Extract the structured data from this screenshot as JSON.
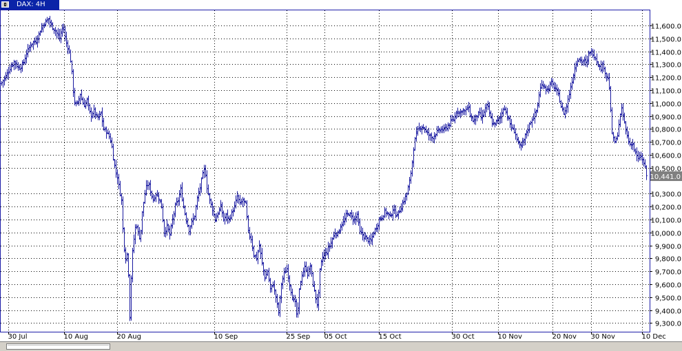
{
  "window": {
    "title": "DAX: 4H"
  },
  "chart_data": {
    "type": "ohlc",
    "symbol": "DAX",
    "timeframe": "4H",
    "x_ticks": [
      "30 Jul",
      "10 Aug",
      "20 Aug",
      "10 Sep",
      "25 Sep",
      "05 Oct",
      "15 Oct",
      "30 Oct",
      "10 Nov",
      "20 Nov",
      "30 Nov",
      "10 Dec"
    ],
    "y_ticks": [
      "11,600.0",
      "11,500.0",
      "11,400.0",
      "11,300.0",
      "11,200.0",
      "11,100.0",
      "11,000.0",
      "10,900.0",
      "10,800.0",
      "10,700.0",
      "10,600.0",
      "10,500.0",
      "10,300.0",
      "10,200.0",
      "10,100.0",
      "10,000.0",
      "9,900.0",
      "9,800.0",
      "9,700.0",
      "9,600.0",
      "9,500.0",
      "9,400.0",
      "9,300.0"
    ],
    "y_range": [
      9250,
      11700
    ],
    "last_price_label": "10,441.0",
    "last_price": 10441,
    "grid": true,
    "colors": {
      "bars": "#1818a0",
      "grid": "#000000",
      "frame": "#1c1ca8",
      "price_tag": "#808080"
    },
    "close_path": [
      [
        1,
        11150
      ],
      [
        7,
        11200
      ],
      [
        13,
        11260
      ],
      [
        20,
        11320
      ],
      [
        27,
        11270
      ],
      [
        33,
        11300
      ],
      [
        39,
        11400
      ],
      [
        45,
        11460
      ],
      [
        52,
        11480
      ],
      [
        58,
        11560
      ],
      [
        64,
        11620
      ],
      [
        70,
        11650
      ],
      [
        74,
        11600
      ],
      [
        80,
        11560
      ],
      [
        86,
        11500
      ],
      [
        91,
        11600
      ],
      [
        95,
        11480
      ],
      [
        99,
        11420
      ],
      [
        103,
        11300
      ],
      [
        107,
        11020
      ],
      [
        111,
        10980
      ],
      [
        116,
        11070
      ],
      [
        121,
        10980
      ],
      [
        126,
        11020
      ],
      [
        131,
        10900
      ],
      [
        136,
        10940
      ],
      [
        141,
        10880
      ],
      [
        146,
        10920
      ],
      [
        150,
        10800
      ],
      [
        154,
        10780
      ],
      [
        158,
        10740
      ],
      [
        161,
        10700
      ],
      [
        164,
        10580
      ],
      [
        167,
        10480
      ],
      [
        170,
        10430
      ],
      [
        173,
        10330
      ],
      [
        176,
        10250
      ],
      [
        179,
        9920
      ],
      [
        182,
        9800
      ],
      [
        185,
        9850
      ],
      [
        188,
        9350
      ],
      [
        191,
        9800
      ],
      [
        194,
        9950
      ],
      [
        197,
        10080
      ],
      [
        200,
        10000
      ],
      [
        203,
        9950
      ],
      [
        206,
        10150
      ],
      [
        209,
        10270
      ],
      [
        212,
        10350
      ],
      [
        215,
        10380
      ],
      [
        218,
        10320
      ],
      [
        222,
        10250
      ],
      [
        226,
        10300
      ],
      [
        230,
        10270
      ],
      [
        234,
        10200
      ],
      [
        238,
        10000
      ],
      [
        242,
        10050
      ],
      [
        246,
        9980
      ],
      [
        250,
        10100
      ],
      [
        254,
        10200
      ],
      [
        258,
        10250
      ],
      [
        262,
        10330
      ],
      [
        266,
        10200
      ],
      [
        270,
        10100
      ],
      [
        274,
        10020
      ],
      [
        278,
        10080
      ],
      [
        282,
        10130
      ],
      [
        286,
        10260
      ],
      [
        290,
        10350
      ],
      [
        294,
        10450
      ],
      [
        297,
        10500
      ],
      [
        300,
        10350
      ],
      [
        304,
        10250
      ],
      [
        308,
        10180
      ],
      [
        312,
        10100
      ],
      [
        316,
        10150
      ],
      [
        320,
        10200
      ],
      [
        324,
        10100
      ],
      [
        328,
        10130
      ],
      [
        332,
        10100
      ],
      [
        336,
        10150
      ],
      [
        340,
        10200
      ],
      [
        344,
        10280
      ],
      [
        348,
        10220
      ],
      [
        352,
        10250
      ],
      [
        356,
        10220
      ],
      [
        360,
        10000
      ],
      [
        364,
        9950
      ],
      [
        368,
        9830
      ],
      [
        372,
        9800
      ],
      [
        376,
        9900
      ],
      [
        380,
        9760
      ],
      [
        384,
        9650
      ],
      [
        388,
        9700
      ],
      [
        392,
        9560
      ],
      [
        396,
        9600
      ],
      [
        400,
        9500
      ],
      [
        404,
        9380
      ],
      [
        408,
        9600
      ],
      [
        412,
        9680
      ],
      [
        416,
        9720
      ],
      [
        420,
        9600
      ],
      [
        424,
        9500
      ],
      [
        428,
        9450
      ],
      [
        431,
        9330
      ],
      [
        434,
        9550
      ],
      [
        437,
        9660
      ],
      [
        440,
        9700
      ],
      [
        443,
        9740
      ],
      [
        446,
        9680
      ],
      [
        450,
        9740
      ],
      [
        454,
        9600
      ],
      [
        458,
        9490
      ],
      [
        461,
        9430
      ],
      [
        464,
        9700
      ],
      [
        467,
        9800
      ],
      [
        470,
        9830
      ],
      [
        474,
        9850
      ],
      [
        478,
        9900
      ],
      [
        482,
        9950
      ],
      [
        486,
        10000
      ],
      [
        490,
        9990
      ],
      [
        494,
        10050
      ],
      [
        498,
        10080
      ],
      [
        502,
        10130
      ],
      [
        506,
        10150
      ],
      [
        510,
        10120
      ],
      [
        514,
        10100
      ],
      [
        518,
        10140
      ],
      [
        522,
        10000
      ],
      [
        526,
        9980
      ],
      [
        530,
        9960
      ],
      [
        534,
        9940
      ],
      [
        538,
        9930
      ],
      [
        542,
        10000
      ],
      [
        546,
        10040
      ],
      [
        550,
        10100
      ],
      [
        554,
        10120
      ],
      [
        558,
        10160
      ],
      [
        562,
        10150
      ],
      [
        566,
        10120
      ],
      [
        570,
        10180
      ],
      [
        574,
        10140
      ],
      [
        578,
        10150
      ],
      [
        582,
        10200
      ],
      [
        586,
        10250
      ],
      [
        590,
        10300
      ],
      [
        594,
        10390
      ],
      [
        597,
        10500
      ],
      [
        600,
        10650
      ],
      [
        603,
        10750
      ],
      [
        607,
        10800
      ],
      [
        611,
        10820
      ],
      [
        615,
        10810
      ],
      [
        619,
        10770
      ],
      [
        623,
        10750
      ],
      [
        627,
        10730
      ],
      [
        631,
        10760
      ],
      [
        635,
        10780
      ],
      [
        639,
        10800
      ],
      [
        643,
        10790
      ],
      [
        647,
        10810
      ],
      [
        651,
        10830
      ],
      [
        655,
        10860
      ],
      [
        659,
        10880
      ],
      [
        663,
        10950
      ],
      [
        667,
        10920
      ],
      [
        671,
        10950
      ],
      [
        675,
        10930
      ],
      [
        679,
        10980
      ],
      [
        683,
        10890
      ],
      [
        687,
        10860
      ],
      [
        691,
        10900
      ],
      [
        695,
        10920
      ],
      [
        699,
        10880
      ],
      [
        703,
        10950
      ],
      [
        707,
        10980
      ],
      [
        711,
        10900
      ],
      [
        715,
        10830
      ],
      [
        719,
        10850
      ],
      [
        723,
        10870
      ],
      [
        727,
        10900
      ],
      [
        731,
        10980
      ],
      [
        735,
        10920
      ],
      [
        739,
        10850
      ],
      [
        743,
        10800
      ],
      [
        747,
        10780
      ],
      [
        751,
        10700
      ],
      [
        755,
        10650
      ],
      [
        759,
        10700
      ],
      [
        763,
        10760
      ],
      [
        767,
        10820
      ],
      [
        771,
        10870
      ],
      [
        775,
        10900
      ],
      [
        779,
        10950
      ],
      [
        783,
        11100
      ],
      [
        787,
        11150
      ],
      [
        791,
        11120
      ],
      [
        795,
        11100
      ],
      [
        799,
        11160
      ],
      [
        803,
        11130
      ],
      [
        807,
        11100
      ],
      [
        811,
        11050
      ],
      [
        815,
        10950
      ],
      [
        819,
        10920
      ],
      [
        823,
        11000
      ],
      [
        827,
        11100
      ],
      [
        831,
        11200
      ],
      [
        835,
        11300
      ],
      [
        839,
        11350
      ],
      [
        843,
        11320
      ],
      [
        847,
        11330
      ],
      [
        851,
        11300
      ],
      [
        855,
        11400
      ],
      [
        859,
        11390
      ],
      [
        863,
        11360
      ],
      [
        867,
        11320
      ],
      [
        871,
        11260
      ],
      [
        875,
        11300
      ],
      [
        879,
        11220
      ],
      [
        883,
        11180
      ],
      [
        885,
        11060
      ],
      [
        887,
        10800
      ],
      [
        890,
        10720
      ],
      [
        893,
        10690
      ],
      [
        896,
        10760
      ],
      [
        899,
        10880
      ],
      [
        902,
        10950
      ],
      [
        905,
        10880
      ],
      [
        908,
        10790
      ],
      [
        911,
        10720
      ],
      [
        914,
        10680
      ],
      [
        917,
        10700
      ],
      [
        920,
        10640
      ],
      [
        923,
        10600
      ],
      [
        926,
        10560
      ],
      [
        929,
        10600
      ],
      [
        932,
        10560
      ],
      [
        935,
        10520
      ],
      [
        938,
        10441
      ]
    ]
  }
}
